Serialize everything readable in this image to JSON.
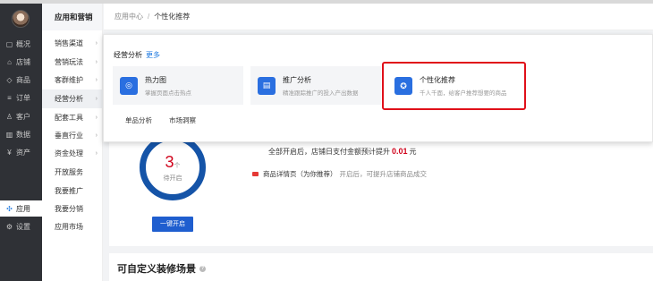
{
  "sidebar": {
    "items": [
      {
        "icon": "overview-icon",
        "glyph": "▢",
        "label": "概况"
      },
      {
        "icon": "store-icon",
        "glyph": "⌂",
        "label": "店铺"
      },
      {
        "icon": "product-icon",
        "glyph": "◇",
        "label": "商品"
      },
      {
        "icon": "order-icon",
        "glyph": "≡",
        "label": "订单"
      },
      {
        "icon": "customer-icon",
        "glyph": "♙",
        "label": "客户"
      },
      {
        "icon": "data-icon",
        "glyph": "▥",
        "label": "数据"
      },
      {
        "icon": "asset-icon",
        "glyph": "¥",
        "label": "资产"
      },
      {
        "icon": "apps-icon",
        "glyph": "✣",
        "label": "应用"
      },
      {
        "icon": "settings-icon",
        "glyph": "⚙",
        "label": "设置"
      }
    ],
    "active": "应用"
  },
  "submenu": {
    "title": "应用和营销",
    "items": [
      {
        "label": "销售渠道",
        "arrow": "›"
      },
      {
        "label": "营销玩法",
        "arrow": "›"
      },
      {
        "label": "客群维护",
        "arrow": "›"
      },
      {
        "label": "经营分析",
        "arrow": "›"
      },
      {
        "label": "配套工具",
        "arrow": "›"
      },
      {
        "label": "垂直行业",
        "arrow": "›"
      },
      {
        "label": "资金处理",
        "arrow": "›"
      },
      {
        "label": "开放服务",
        "arrow": ""
      },
      {
        "label": "我要推广",
        "arrow": ""
      },
      {
        "label": "我要分销",
        "arrow": ""
      },
      {
        "label": "应用市场",
        "arrow": ""
      }
    ]
  },
  "breadcrumb": {
    "root": "应用中心",
    "sep": "/",
    "current": "个性化推荐"
  },
  "dropdown": {
    "title": "经营分析",
    "more": "更多",
    "tiles": [
      {
        "title": "热力图",
        "desc": "掌握页面点击热点",
        "icon": "heatmap-icon",
        "glyph": "◎"
      },
      {
        "title": "推广分析",
        "desc": "精准跟踪推广的投入产出数据",
        "icon": "promotion-chart-icon",
        "glyph": "▤"
      },
      {
        "title": "个性化推荐",
        "desc": "千人千面，给客户推荐想要的商品",
        "icon": "badge-icon",
        "glyph": "✪"
      }
    ],
    "links": [
      "单品分析",
      "市场洞察"
    ]
  },
  "status": {
    "count": "3",
    "unit": "个",
    "label": "待开启",
    "button": "一键开启",
    "summary_prefix": "全部开启后，店铺日支付金额预计提升",
    "summary_value": "0.01",
    "summary_unit": "元",
    "scene_name": "商品详情页（为你推荐）",
    "scene_desc": "开启后，可提升店铺商品成交"
  },
  "section": {
    "title": "可自定义装修场景",
    "help": "?"
  },
  "colors": {
    "primary": "#1f5ecf",
    "highlight_border": "#e0101a",
    "accent_red": "#d0021b",
    "sidebar_bg": "#2f3136"
  }
}
